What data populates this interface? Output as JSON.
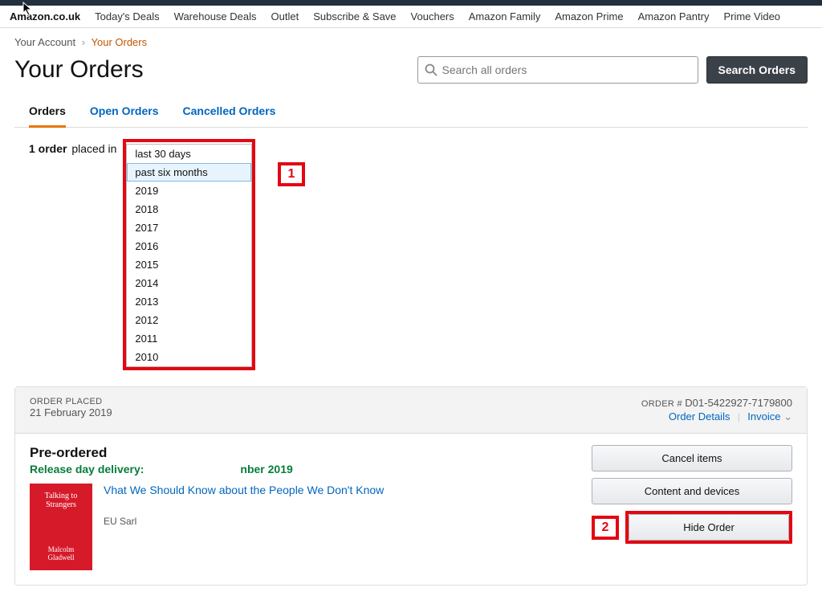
{
  "subnav": {
    "site": "Amazon.co.uk",
    "links": [
      "Today's Deals",
      "Warehouse Deals",
      "Outlet",
      "Subscribe & Save",
      "Vouchers",
      "Amazon Family",
      "Amazon Prime",
      "Amazon Pantry",
      "Prime Video"
    ]
  },
  "breadcrumb": {
    "account": "Your Account",
    "current": "Your Orders"
  },
  "page": {
    "title": "Your Orders",
    "search_placeholder": "Search all orders",
    "search_button": "Search Orders"
  },
  "tabs": {
    "orders": "Orders",
    "open": "Open Orders",
    "cancelled": "Cancelled Orders"
  },
  "filter": {
    "count_text": "1 order",
    "placed_in": "placed in",
    "options": [
      "last 30 days",
      "past six months",
      "2019",
      "2018",
      "2017",
      "2016",
      "2015",
      "2014",
      "2013",
      "2012",
      "2011",
      "2010"
    ],
    "selected": "past six months"
  },
  "order": {
    "placed_label": "ORDER PLACED",
    "placed_value": "21 February 2019",
    "order_num_label": "ORDER #",
    "order_num_value": "D01-5422927-7179800",
    "details_link": "Order Details",
    "invoice_link": "Invoice",
    "preordered_title": "Pre-ordered",
    "delivery_prefix": "Release day delivery:",
    "delivery_date_suffix": "nber 2019",
    "product_title_prefix": "Vhat We Should Know about the People We Don't Know",
    "book_title": "Talking to Strangers",
    "book_author": "Malcolm Gladwell",
    "sold_by_suffix": "EU Sarl",
    "actions": {
      "cancel": "Cancel items",
      "content": "Content and devices",
      "hide": "Hide Order"
    }
  },
  "callouts": {
    "one": "1",
    "two": "2"
  }
}
